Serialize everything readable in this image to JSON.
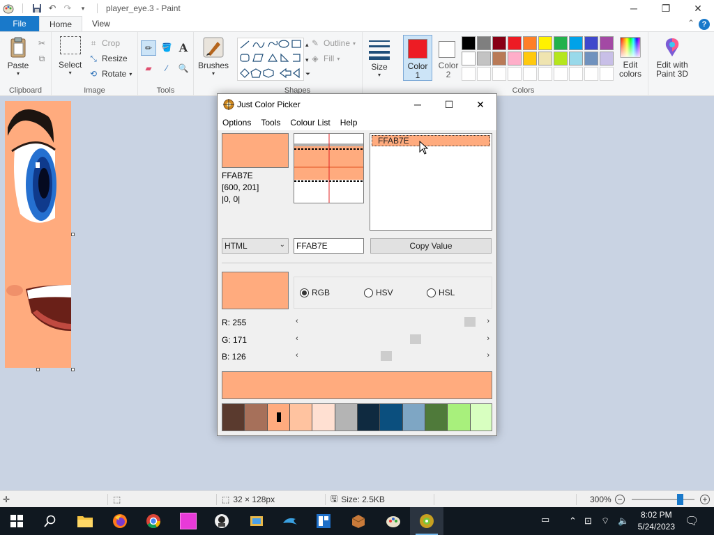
{
  "app": {
    "window_title": "player_eye.3 - Paint"
  },
  "ribbon": {
    "tabs": [
      {
        "label": "File"
      },
      {
        "label": "Home"
      },
      {
        "label": "View"
      }
    ],
    "clipboard": {
      "paste": "Paste",
      "group": "Clipboard"
    },
    "image": {
      "select": "Select",
      "crop": "Crop",
      "resize": "Resize",
      "rotate": "Rotate",
      "group": "Image"
    },
    "tools": {
      "group": "Tools"
    },
    "brushes": {
      "label": "Brushes"
    },
    "shapes": {
      "outline": "Outline",
      "fill": "Fill",
      "group": "Shapes"
    },
    "size": {
      "label": "Size"
    },
    "color1": {
      "label": "Color",
      "num": "1",
      "color": "#ed1c24"
    },
    "color2": {
      "label": "Color",
      "num": "2",
      "color": "#ffffff"
    },
    "colors_group": "Colors",
    "palette_row1": [
      "#000000",
      "#7f7f7f",
      "#880015",
      "#ed1c24",
      "#ff7f27",
      "#fff200",
      "#22b14c",
      "#00a2e8",
      "#3f48cc",
      "#a349a4"
    ],
    "palette_row2": [
      "#ffffff",
      "#c3c3c3",
      "#b97a57",
      "#ffaec9",
      "#ffc90e",
      "#efe4b0",
      "#b5e61d",
      "#99d9ea",
      "#7092be",
      "#c8bfe7"
    ],
    "edit_colors": {
      "line1": "Edit",
      "line2": "colors"
    },
    "paint3d": {
      "line1": "Edit with",
      "line2": "Paint 3D"
    }
  },
  "statusbar": {
    "dimensions": "32 × 128px",
    "size": "Size: 2.5KB",
    "zoom": "300%",
    "zoom_level": 300
  },
  "taskbar": {
    "time": "8:02 PM",
    "date": "5/24/2023"
  },
  "color_picker": {
    "title": "Just Color Picker",
    "menu": [
      "Options",
      "Tools",
      "Colour List",
      "Help"
    ],
    "current_color": "#ffab7e",
    "hex": "FFAB7E",
    "coords": "[600, 201]",
    "offset": "|0, 0|",
    "list_item": "FFAB7E",
    "format": "HTML",
    "value": "FFAB7E",
    "copy_button": "Copy Value",
    "modes": [
      "RGB",
      "HSV",
      "HSL"
    ],
    "selected_mode": "RGB",
    "r_label": "R: 255",
    "g_label": "G: 171",
    "b_label": "B: 126",
    "r": 255,
    "g": 171,
    "b": 126,
    "history": [
      "#5a3a2e",
      "#a6705a",
      "#ffab7e",
      "#ffc3a0",
      "#ffe0d2",
      "#b4b4b4",
      "#0f2a40",
      "#0b4f7e",
      "#7ea6c4",
      "#4f7a3a",
      "#a8f07c",
      "#d8ffc0"
    ]
  }
}
